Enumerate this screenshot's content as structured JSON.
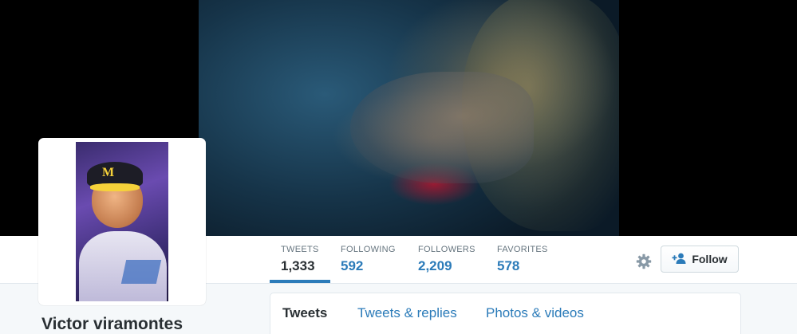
{
  "profile": {
    "name": "Victor viramontes"
  },
  "stats": {
    "tweets": {
      "label": "TWEETS",
      "value": "1,333"
    },
    "following": {
      "label": "FOLLOWING",
      "value": "592"
    },
    "followers": {
      "label": "FOLLOWERS",
      "value": "2,209"
    },
    "favorites": {
      "label": "FAVORITES",
      "value": "578"
    }
  },
  "actions": {
    "follow_label": "Follow",
    "settings_icon": "gear-icon",
    "follow_icon": "add-person-icon"
  },
  "timeline_tabs": [
    {
      "label": "Tweets"
    },
    {
      "label": "Tweets & replies"
    },
    {
      "label": "Photos & videos"
    }
  ],
  "colors": {
    "accent": "#2b7bb9",
    "text": "#292f33",
    "muted": "#66757f",
    "background": "#f5f8fa"
  }
}
